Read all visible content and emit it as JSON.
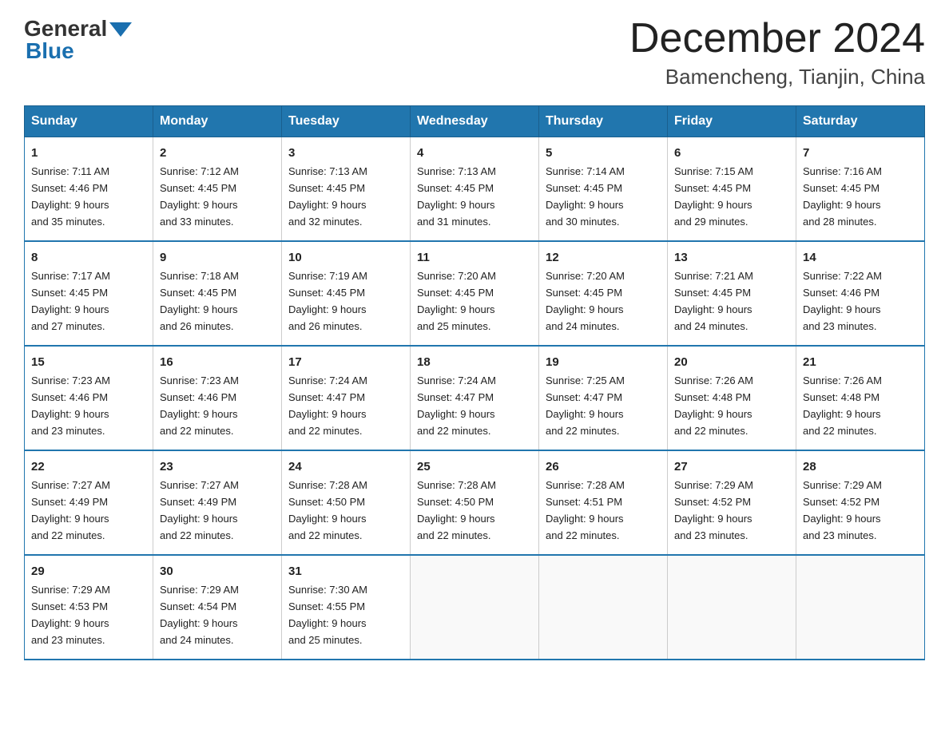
{
  "header": {
    "logo_general": "General",
    "logo_blue": "Blue",
    "month_title": "December 2024",
    "location": "Bamencheng, Tianjin, China"
  },
  "days_of_week": [
    "Sunday",
    "Monday",
    "Tuesday",
    "Wednesday",
    "Thursday",
    "Friday",
    "Saturday"
  ],
  "weeks": [
    [
      {
        "num": "1",
        "sunrise": "7:11 AM",
        "sunset": "4:46 PM",
        "daylight": "9 hours and 35 minutes."
      },
      {
        "num": "2",
        "sunrise": "7:12 AM",
        "sunset": "4:45 PM",
        "daylight": "9 hours and 33 minutes."
      },
      {
        "num": "3",
        "sunrise": "7:13 AM",
        "sunset": "4:45 PM",
        "daylight": "9 hours and 32 minutes."
      },
      {
        "num": "4",
        "sunrise": "7:13 AM",
        "sunset": "4:45 PM",
        "daylight": "9 hours and 31 minutes."
      },
      {
        "num": "5",
        "sunrise": "7:14 AM",
        "sunset": "4:45 PM",
        "daylight": "9 hours and 30 minutes."
      },
      {
        "num": "6",
        "sunrise": "7:15 AM",
        "sunset": "4:45 PM",
        "daylight": "9 hours and 29 minutes."
      },
      {
        "num": "7",
        "sunrise": "7:16 AM",
        "sunset": "4:45 PM",
        "daylight": "9 hours and 28 minutes."
      }
    ],
    [
      {
        "num": "8",
        "sunrise": "7:17 AM",
        "sunset": "4:45 PM",
        "daylight": "9 hours and 27 minutes."
      },
      {
        "num": "9",
        "sunrise": "7:18 AM",
        "sunset": "4:45 PM",
        "daylight": "9 hours and 26 minutes."
      },
      {
        "num": "10",
        "sunrise": "7:19 AM",
        "sunset": "4:45 PM",
        "daylight": "9 hours and 26 minutes."
      },
      {
        "num": "11",
        "sunrise": "7:20 AM",
        "sunset": "4:45 PM",
        "daylight": "9 hours and 25 minutes."
      },
      {
        "num": "12",
        "sunrise": "7:20 AM",
        "sunset": "4:45 PM",
        "daylight": "9 hours and 24 minutes."
      },
      {
        "num": "13",
        "sunrise": "7:21 AM",
        "sunset": "4:45 PM",
        "daylight": "9 hours and 24 minutes."
      },
      {
        "num": "14",
        "sunrise": "7:22 AM",
        "sunset": "4:46 PM",
        "daylight": "9 hours and 23 minutes."
      }
    ],
    [
      {
        "num": "15",
        "sunrise": "7:23 AM",
        "sunset": "4:46 PM",
        "daylight": "9 hours and 23 minutes."
      },
      {
        "num": "16",
        "sunrise": "7:23 AM",
        "sunset": "4:46 PM",
        "daylight": "9 hours and 22 minutes."
      },
      {
        "num": "17",
        "sunrise": "7:24 AM",
        "sunset": "4:47 PM",
        "daylight": "9 hours and 22 minutes."
      },
      {
        "num": "18",
        "sunrise": "7:24 AM",
        "sunset": "4:47 PM",
        "daylight": "9 hours and 22 minutes."
      },
      {
        "num": "19",
        "sunrise": "7:25 AM",
        "sunset": "4:47 PM",
        "daylight": "9 hours and 22 minutes."
      },
      {
        "num": "20",
        "sunrise": "7:26 AM",
        "sunset": "4:48 PM",
        "daylight": "9 hours and 22 minutes."
      },
      {
        "num": "21",
        "sunrise": "7:26 AM",
        "sunset": "4:48 PM",
        "daylight": "9 hours and 22 minutes."
      }
    ],
    [
      {
        "num": "22",
        "sunrise": "7:27 AM",
        "sunset": "4:49 PM",
        "daylight": "9 hours and 22 minutes."
      },
      {
        "num": "23",
        "sunrise": "7:27 AM",
        "sunset": "4:49 PM",
        "daylight": "9 hours and 22 minutes."
      },
      {
        "num": "24",
        "sunrise": "7:28 AM",
        "sunset": "4:50 PM",
        "daylight": "9 hours and 22 minutes."
      },
      {
        "num": "25",
        "sunrise": "7:28 AM",
        "sunset": "4:50 PM",
        "daylight": "9 hours and 22 minutes."
      },
      {
        "num": "26",
        "sunrise": "7:28 AM",
        "sunset": "4:51 PM",
        "daylight": "9 hours and 22 minutes."
      },
      {
        "num": "27",
        "sunrise": "7:29 AM",
        "sunset": "4:52 PM",
        "daylight": "9 hours and 23 minutes."
      },
      {
        "num": "28",
        "sunrise": "7:29 AM",
        "sunset": "4:52 PM",
        "daylight": "9 hours and 23 minutes."
      }
    ],
    [
      {
        "num": "29",
        "sunrise": "7:29 AM",
        "sunset": "4:53 PM",
        "daylight": "9 hours and 23 minutes."
      },
      {
        "num": "30",
        "sunrise": "7:29 AM",
        "sunset": "4:54 PM",
        "daylight": "9 hours and 24 minutes."
      },
      {
        "num": "31",
        "sunrise": "7:30 AM",
        "sunset": "4:55 PM",
        "daylight": "9 hours and 25 minutes."
      },
      null,
      null,
      null,
      null
    ]
  ],
  "labels": {
    "sunrise": "Sunrise:",
    "sunset": "Sunset:",
    "daylight": "Daylight:"
  }
}
